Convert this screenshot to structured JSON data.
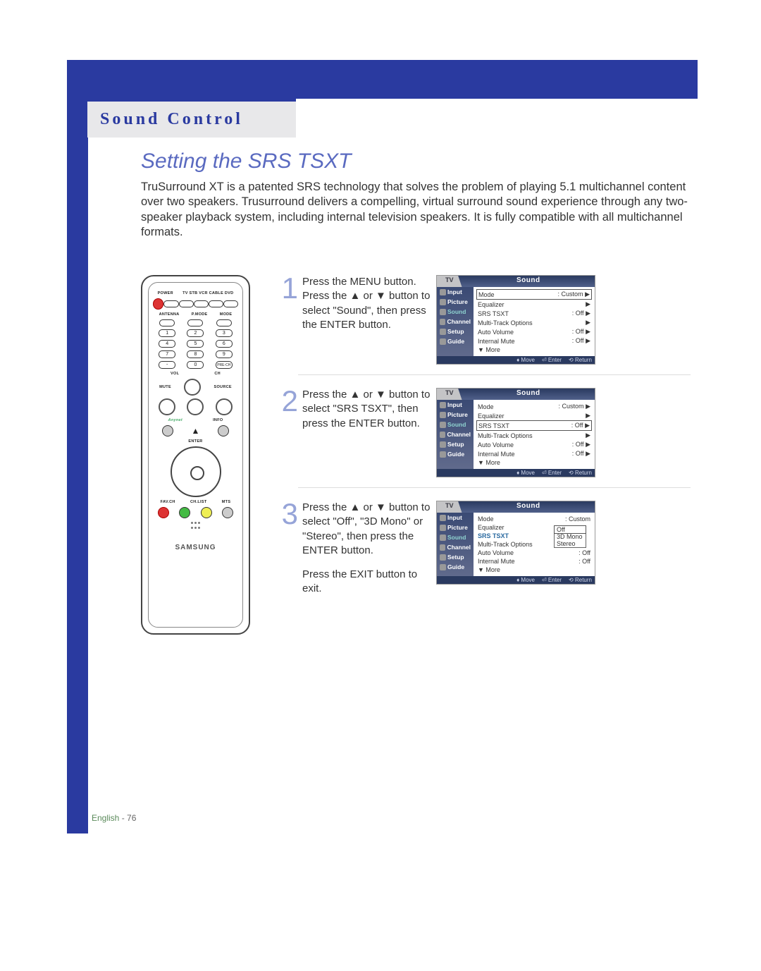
{
  "tab_title": "Sound Control",
  "section_title": "Setting the SRS TSXT",
  "intro": "TruSurround XT is a patented SRS technology that solves the problem of playing 5.1 multichannel content over two speakers. Trusurround delivers a compelling, virtual surround sound experience through any two-speaker playback system, including internal television speakers. It is fully compatible with all multichannel formats.",
  "remote": {
    "power": "POWER",
    "device_row": "TV   STB   VCR   CABLE   DVD",
    "antenna": "ANTENNA",
    "pmode": "P.MODE",
    "mode": "MODE",
    "source": "SOURCE",
    "mute": "MUTE",
    "vol": "VOL",
    "ch": "CH",
    "prech": "PRE-CH",
    "enter": "ENTER",
    "info": "INFO",
    "favch": "FAV.CH",
    "chlist": "CH.LIST",
    "mts": "MTS",
    "brand": "SAMSUNG",
    "numbers": [
      "1",
      "2",
      "3",
      "4",
      "5",
      "6",
      "7",
      "8",
      "9",
      "-",
      "0"
    ]
  },
  "steps": [
    {
      "num": "1",
      "text": "Press the MENU button. Press the ▲ or ▼ button to select \"Sound\", then press the ENTER button."
    },
    {
      "num": "2",
      "text": "Press the ▲ or ▼ button to select \"SRS TSXT\", then press the ENTER button."
    },
    {
      "num": "3",
      "text": "Press the ▲ or ▼ button to select \"Off\", \"3D Mono\" or \"Stereo\", then press the ENTER button.",
      "text2": "Press the EXIT button to exit."
    }
  ],
  "osd": {
    "tv": "TV",
    "title": "Sound",
    "side": [
      "Input",
      "Picture",
      "Sound",
      "Channel",
      "Setup",
      "Guide"
    ],
    "rows_1": [
      {
        "l": "Mode",
        "r": ": Custom",
        "sel": true
      },
      {
        "l": "Equalizer",
        "r": ""
      },
      {
        "l": "SRS TSXT",
        "r": ": Off"
      },
      {
        "l": "Multi-Track Options",
        "r": ""
      },
      {
        "l": "Auto Volume",
        "r": ": Off"
      },
      {
        "l": "Internal Mute",
        "r": ": Off"
      },
      {
        "l": "▼ More",
        "r": ""
      }
    ],
    "rows_2": [
      {
        "l": "Mode",
        "r": ": Custom"
      },
      {
        "l": "Equalizer",
        "r": ""
      },
      {
        "l": "SRS TSXT",
        "r": ": Off",
        "sel": true
      },
      {
        "l": "Multi-Track Options",
        "r": ""
      },
      {
        "l": "Auto Volume",
        "r": ": Off"
      },
      {
        "l": "Internal Mute",
        "r": ": Off"
      },
      {
        "l": "▼ More",
        "r": ""
      }
    ],
    "rows_3": [
      {
        "l": "Mode",
        "r": ": Custom"
      },
      {
        "l": "Equalizer",
        "r": ""
      },
      {
        "l": "SRS TSXT",
        "r": "",
        "srs": true
      },
      {
        "l": "Multi-Track Options",
        "r": ""
      },
      {
        "l": "Auto Volume",
        "r": ": Off"
      },
      {
        "l": "Internal Mute",
        "r": ": Off"
      },
      {
        "l": "▼ More",
        "r": ""
      }
    ],
    "popup": [
      "Off",
      "3D Mono",
      "Stereo"
    ],
    "foot": {
      "move": "Move",
      "enter": "Enter",
      "ret": "Return"
    }
  },
  "footer": {
    "lang": "English",
    "page": " - 76"
  }
}
